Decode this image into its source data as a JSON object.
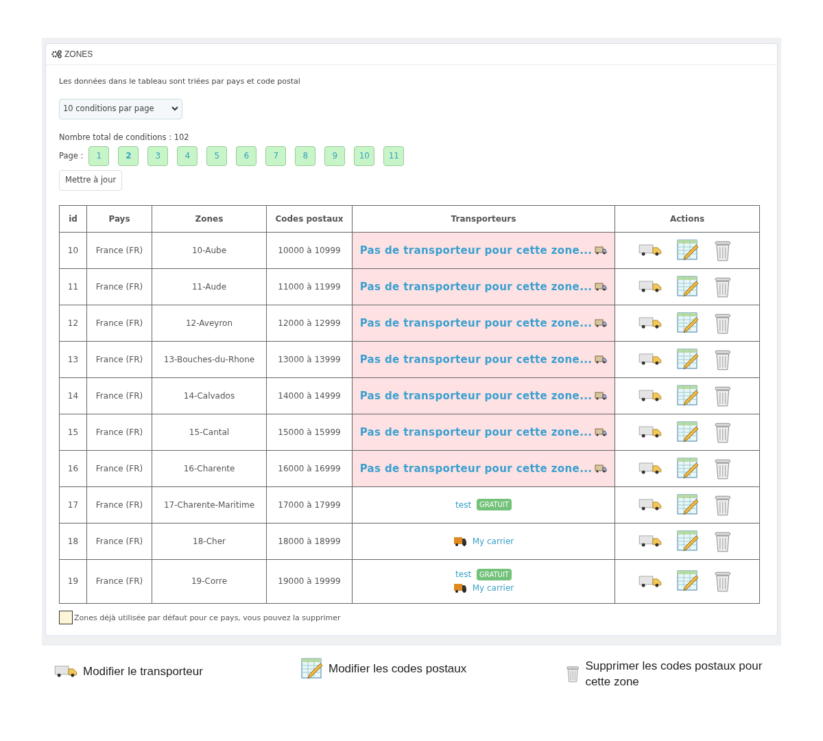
{
  "panel": {
    "title": "ZONES"
  },
  "intro": "Les données dans le tableau sont triées par pays et code postal",
  "per_page": {
    "value": "10 conditions par page"
  },
  "total": "Nombre total de conditions : 102",
  "page_label": "Page :",
  "pages": [
    {
      "label": "1",
      "selected": false
    },
    {
      "label": "2",
      "selected": true
    },
    {
      "label": "3",
      "selected": false
    },
    {
      "label": "4",
      "selected": false
    },
    {
      "label": "5",
      "selected": false
    },
    {
      "label": "6",
      "selected": false
    },
    {
      "label": "7",
      "selected": false
    },
    {
      "label": "8",
      "selected": false
    },
    {
      "label": "9",
      "selected": false
    },
    {
      "label": "10",
      "selected": false
    },
    {
      "label": "11",
      "selected": false
    }
  ],
  "update_button": "Mettre à jour",
  "table": {
    "columns": [
      "id",
      "Pays",
      "Zones",
      "Codes postaux",
      "Transporteurs",
      "Actions"
    ],
    "rows": [
      {
        "id": "10",
        "pays": "France (FR)",
        "zone": "10-Aube",
        "codes": "10000 à 10999",
        "carriers": [
          {
            "kind": "none",
            "name": "Pas de transporteur pour cette zone..."
          }
        ]
      },
      {
        "id": "11",
        "pays": "France (FR)",
        "zone": "11-Aude",
        "codes": "11000 à 11999",
        "carriers": [
          {
            "kind": "none",
            "name": "Pas de transporteur pour cette zone..."
          }
        ]
      },
      {
        "id": "12",
        "pays": "France (FR)",
        "zone": "12-Aveyron",
        "codes": "12000 à 12999",
        "carriers": [
          {
            "kind": "none",
            "name": "Pas de transporteur pour cette zone..."
          }
        ]
      },
      {
        "id": "13",
        "pays": "France (FR)",
        "zone": "13-Bouches-du-Rhone",
        "codes": "13000 à 13999",
        "carriers": [
          {
            "kind": "none",
            "name": "Pas de transporteur pour cette zone..."
          }
        ]
      },
      {
        "id": "14",
        "pays": "France (FR)",
        "zone": "14-Calvados",
        "codes": "14000 à 14999",
        "carriers": [
          {
            "kind": "none",
            "name": "Pas de transporteur pour cette zone..."
          }
        ]
      },
      {
        "id": "15",
        "pays": "France (FR)",
        "zone": "15-Cantal",
        "codes": "15000 à 15999",
        "carriers": [
          {
            "kind": "none",
            "name": "Pas de transporteur pour cette zone..."
          }
        ]
      },
      {
        "id": "16",
        "pays": "France (FR)",
        "zone": "16-Charente",
        "codes": "16000 à 16999",
        "carriers": [
          {
            "kind": "none",
            "name": "Pas de transporteur pour cette zone..."
          }
        ]
      },
      {
        "id": "17",
        "pays": "France (FR)",
        "zone": "17-Charente-Maritime",
        "codes": "17000 à 17999",
        "carriers": [
          {
            "kind": "free",
            "name": "test",
            "badge": "GRATUIT"
          }
        ]
      },
      {
        "id": "18",
        "pays": "France (FR)",
        "zone": "18-Cher",
        "codes": "18000 à 18999",
        "carriers": [
          {
            "kind": "icon",
            "name": "My carrier"
          }
        ]
      },
      {
        "id": "19",
        "pays": "France (FR)",
        "zone": "19-Corre",
        "codes": "19000 à 19999",
        "carriers": [
          {
            "kind": "free",
            "name": "test",
            "badge": "GRATUIT"
          },
          {
            "kind": "icon",
            "name": "My carrier"
          }
        ]
      }
    ]
  },
  "note": "Zones déjà utilisée par défaut pour ce pays, vous pouvez la supprimer",
  "legend": [
    {
      "kind": "truck",
      "label": "Modifier le transporteur"
    },
    {
      "kind": "edit",
      "label": "Modifier les codes postaux"
    },
    {
      "kind": "trash",
      "label": "Supprimer les codes postaux pour cette zone"
    }
  ]
}
